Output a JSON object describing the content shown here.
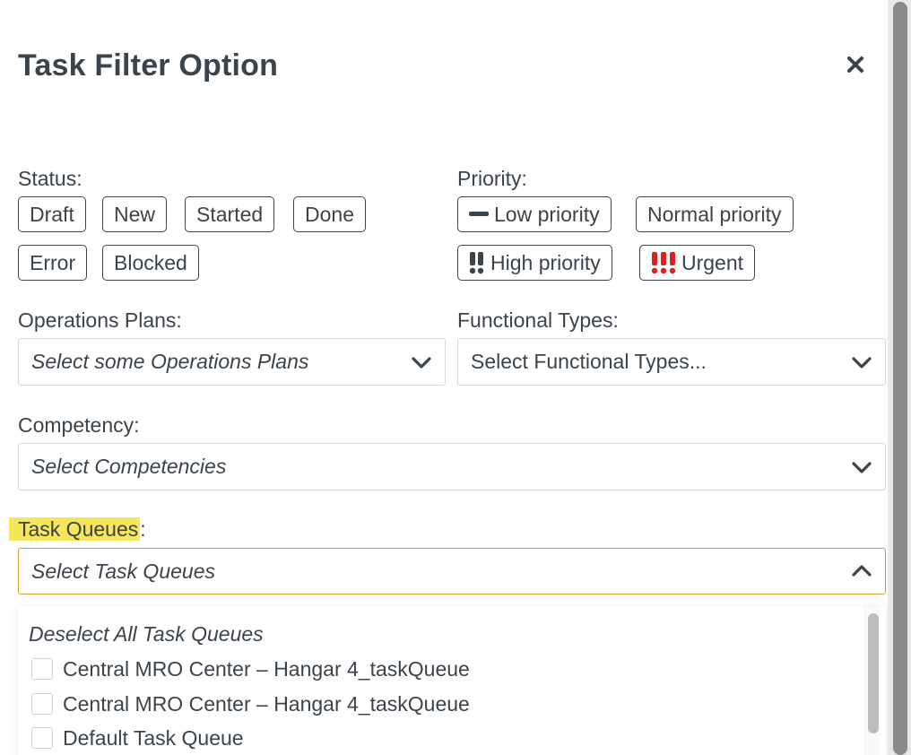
{
  "dialog": {
    "title": "Task Filter Option",
    "close_icon": "close-icon"
  },
  "status": {
    "label": "Status:",
    "options": [
      "Draft",
      "New",
      "Started",
      "Done",
      "Error",
      "Blocked"
    ]
  },
  "priority": {
    "label": "Priority:",
    "options": [
      {
        "label": "Low priority",
        "icon": "dash-icon"
      },
      {
        "label": "Normal priority",
        "icon": ""
      },
      {
        "label": "High priority",
        "icon": "double-exclamation-icon"
      },
      {
        "label": "Urgent",
        "icon": "triple-exclamation-icon"
      }
    ],
    "urgent_color": "#e02020"
  },
  "operations_plans": {
    "label": "Operations Plans:",
    "placeholder": "Select some Operations Plans"
  },
  "functional_types": {
    "label": "Functional Types:",
    "placeholder": "Select Functional Types..."
  },
  "competency": {
    "label": "Competency:",
    "placeholder": "Select Competencies"
  },
  "task_queues": {
    "label_highlighted": "Task Queues",
    "label_suffix": ":",
    "placeholder": "Select Task Queues",
    "highlight_color": "#f7e55a",
    "focus_border_color": "#d4a02e",
    "dropdown": {
      "deselect_all": "Deselect All Task Queues",
      "items": [
        "Central MRO Center – Hangar 4_taskQueue",
        "Central MRO Center – Hangar 4_taskQueue",
        "Default Task Queue"
      ]
    }
  }
}
